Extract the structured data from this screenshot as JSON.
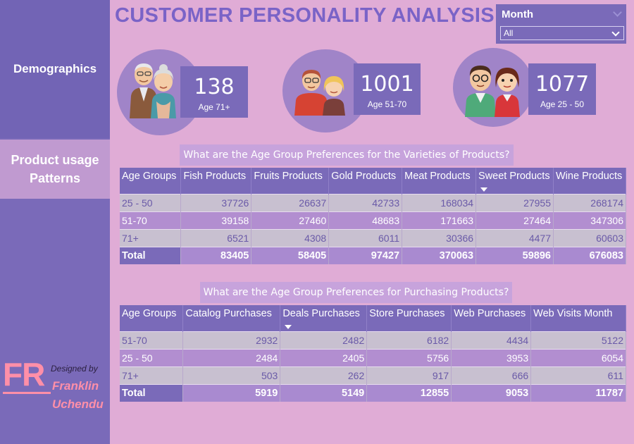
{
  "title": "CUSTOMER PERSONALITY ANALYSIS",
  "sidebar": {
    "items": [
      {
        "label": "Demographics"
      },
      {
        "label": "Product usage Patterns"
      }
    ],
    "brand": {
      "initials": "FR",
      "designed_by": "Designed by",
      "first_name": "Franklin",
      "last_name": "Uchendu"
    }
  },
  "slicer": {
    "title": "Month",
    "value": "All"
  },
  "kpis": [
    {
      "value": "138",
      "label": "Age 71+",
      "icon": "elderly-couple-icon"
    },
    {
      "value": "1001",
      "label": "Age 51-70",
      "icon": "middle-aged-couple-icon"
    },
    {
      "value": "1077",
      "label": "Age 25 - 50",
      "icon": "young-couple-icon"
    }
  ],
  "table1": {
    "caption": "What are the Age Group Preferences for the Varieties of Products?",
    "columns": [
      "Age Groups",
      "Fish Products",
      "Fruits Products",
      "Gold Products",
      "Meat Products",
      "Sweet Products",
      "Wine Products"
    ],
    "rows": [
      [
        "25 - 50",
        "37726",
        "26637",
        "42733",
        "168034",
        "27955",
        "268174"
      ],
      [
        "51-70",
        "39158",
        "27460",
        "48683",
        "171663",
        "27464",
        "347306"
      ],
      [
        "71+",
        "6521",
        "4308",
        "6011",
        "30366",
        "4477",
        "60603"
      ]
    ],
    "total": [
      "Total",
      "83405",
      "58405",
      "97427",
      "370063",
      "59896",
      "676083"
    ]
  },
  "table2": {
    "caption": "What are the Age Group Preferences for Purchasing Products?",
    "columns": [
      "Age Groups",
      "Catalog Purchases",
      "Deals Purchases",
      "Store Purchases",
      "Web Purchases",
      "Web Visits Month"
    ],
    "rows": [
      [
        "51-70",
        "2932",
        "2482",
        "6182",
        "4434",
        "5122"
      ],
      [
        "25 - 50",
        "2484",
        "2405",
        "5756",
        "3953",
        "6054"
      ],
      [
        "71+",
        "503",
        "262",
        "917",
        "666",
        "611"
      ]
    ],
    "total": [
      "Total",
      "5919",
      "5149",
      "12855",
      "9053",
      "11787"
    ]
  },
  "colors": {
    "background": "#e0acd6",
    "sidebar": "#7a6ab9",
    "header": "#7a6ab9",
    "title": "#7a63c7",
    "brand": "#ff8fa8"
  }
}
